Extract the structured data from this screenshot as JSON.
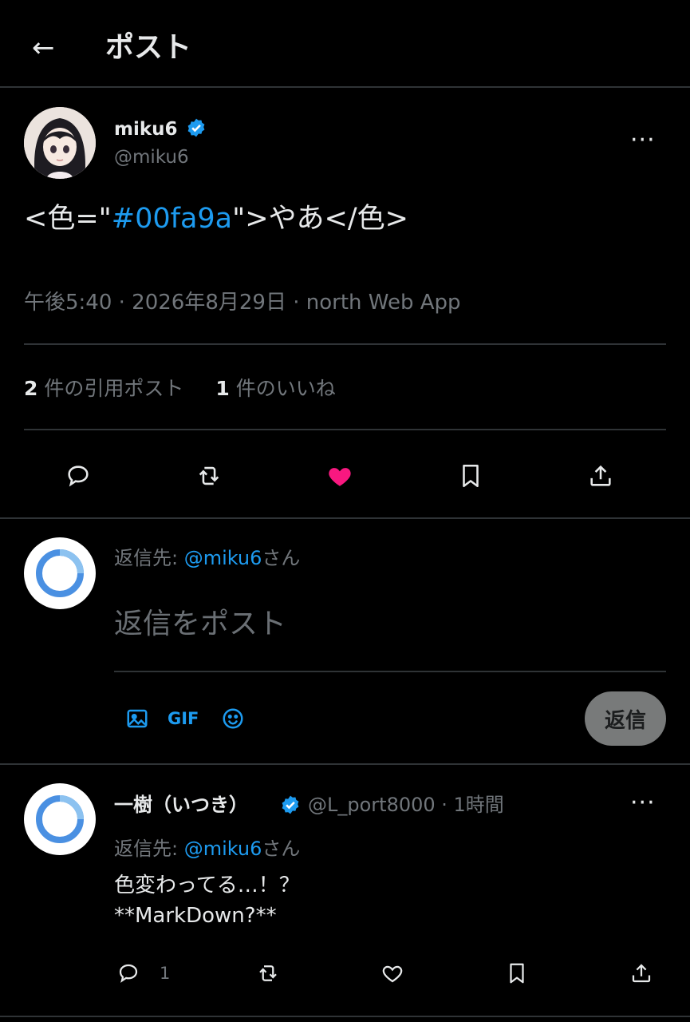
{
  "header": {
    "title": "ポスト"
  },
  "post": {
    "display_name": "miku6",
    "handle": "@miku6",
    "text_before": "<色=\"",
    "text_link": "#00fa9a",
    "text_after": "\">やあ</色>",
    "meta": "午後5:40 · 2026年8月29日 · north Web App",
    "stats": {
      "quote_count": "2",
      "quote_label": " 件の引用ポスト",
      "like_count": "1",
      "like_label": " 件のいいね"
    },
    "liked": true
  },
  "composer": {
    "reply_to_prefix": "返信先: ",
    "reply_to_mention": "@miku6",
    "reply_to_suffix": "さん",
    "placeholder": "返信をポスト",
    "gif_label": "GIF",
    "reply_button": "返信"
  },
  "reply": {
    "display_name": "一樹（いつき）",
    "handle_time": "@L_port8000 · 1時間",
    "reply_to_prefix": "返信先: ",
    "reply_to_mention": "@miku6",
    "reply_to_suffix": "さん",
    "text": "色変わってる…！？\n**MarkDown?**",
    "reply_count": "1"
  },
  "colors": {
    "background": "#000000",
    "text": "#e7e9ea",
    "muted": "#71767b",
    "accent": "#1d9bf0",
    "like": "#f91880",
    "divider": "#2f3336"
  }
}
